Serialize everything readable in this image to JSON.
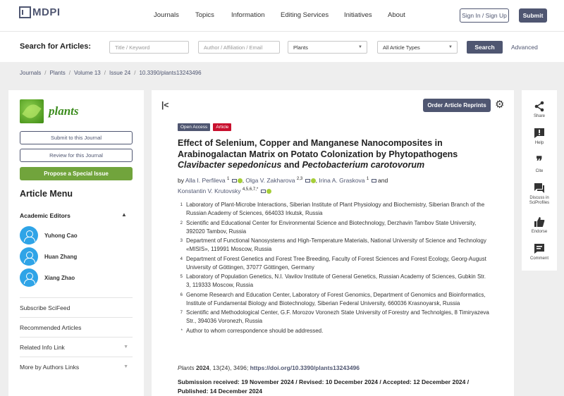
{
  "header": {
    "logo": "MDPI",
    "nav": [
      "Journals",
      "Topics",
      "Information",
      "Editing Services",
      "Initiatives",
      "About"
    ],
    "sign_in": "Sign In / Sign Up",
    "submit": "Submit"
  },
  "search": {
    "label": "Search for Articles:",
    "title_placeholder": "Title / Keyword",
    "author_placeholder": "Author / Affiliation / Email",
    "journal_value": "Plants",
    "type_value": "All Article Types",
    "button": "Search",
    "advanced": "Advanced"
  },
  "breadcrumb": [
    "Journals",
    "Plants",
    "Volume 13",
    "Issue 24",
    "10.3390/plants13243496"
  ],
  "sidebar": {
    "journal_name": "plants",
    "submit_btn": "Submit to this Journal",
    "review_btn": "Review for this Journal",
    "propose_btn": "Propose a Special Issue",
    "menu_title": "Article Menu",
    "academic_editors": "Academic Editors",
    "editors": [
      "Yuhong Cao",
      "Huan Zhang",
      "Xiang Zhao"
    ],
    "links": [
      "Subscribe SciFeed",
      "Recommended Articles",
      "Related Info Link",
      "More by Authors Links"
    ]
  },
  "article": {
    "reprint_btn": "Order Article Reprints",
    "badge_open_access": "Open Access",
    "badge_article": "Article",
    "title_line1": "Effect of Selenium, Copper and Manganese Nanocomposites in",
    "title_line2": "Arabinogalactan Matrix on Potato Colonization by Phytopathogens",
    "title_italic1": "Clavibacter sepedonicus",
    "title_and": " and ",
    "title_italic2": "Pectobacterium carotovorum",
    "by": "by",
    "authors": [
      {
        "name": "Alla I. Perfileva",
        "sup": "1"
      },
      {
        "name": "Olga V. Zakharova",
        "sup": "2,3"
      },
      {
        "name": "Irina A. Graskova",
        "sup": "1"
      },
      {
        "name": "Konstantin V. Krutovsky",
        "sup": "4,5,6,7,*"
      }
    ],
    "and": "and",
    "affiliations": [
      {
        "num": "1",
        "text": "Laboratory of Plant-Microbe Interactions, Siberian Institute of Plant Physiology and Biochemistry, Siberian Branch of the Russian Academy of Sciences, 664033 Irkutsk, Russia"
      },
      {
        "num": "2",
        "text": "Scientific and Educational Center for Environmental Science and Biotechnology, Derzhavin Tambov State University, 392020 Tambov, Russia"
      },
      {
        "num": "3",
        "text": "Department of Functional Nanosystems and High-Temperature Materials, National University of Science and Technology «MISIS», 119991 Moscow, Russia"
      },
      {
        "num": "4",
        "text": "Department of Forest Genetics and Forest Tree Breeding, Faculty of Forest Sciences and Forest Ecology, Georg-August University of Göttingen, 37077 Göttingen, Germany"
      },
      {
        "num": "5",
        "text": "Laboratory of Population Genetics, N.I. Vavilov Institute of General Genetics, Russian Academy of Sciences, Gubkin Str. 3, 119333 Moscow, Russia"
      },
      {
        "num": "6",
        "text": "Genome Research and Education Center, Laboratory of Forest Genomics, Department of Genomics and Bioinformatics, Institute of Fundamental Biology and Biotechnology, Siberian Federal University, 660036 Krasnoyarsk, Russia"
      },
      {
        "num": "7",
        "text": "Scientific and Methodological Center, G.F. Morozov Voronezh State University of Forestry and Technolgies, 8 Timiryazeva Str., 394036 Voronezh, Russia"
      },
      {
        "num": "*",
        "text": "Author to whom correspondence should be addressed."
      }
    ],
    "citation_journal": "Plants",
    "citation_year": "2024",
    "citation_rest": ", 13(24), 3496; ",
    "doi": "https://doi.org/10.3390/plants13243496",
    "dates": "Submission received: 19 November 2024 / Revised: 10 December 2024 / Accepted: 12 December 2024 / Published: 14 December 2024"
  },
  "actions": [
    {
      "icon": "share-icon",
      "label": "Share"
    },
    {
      "icon": "help-icon",
      "label": "Help"
    },
    {
      "icon": "cite-icon",
      "label": "Cite"
    },
    {
      "icon": "discuss-icon",
      "label": "Discuss in SciProfiles"
    },
    {
      "icon": "endorse-icon",
      "label": "Endorse"
    },
    {
      "icon": "comment-icon",
      "label": "Comment"
    }
  ],
  "colors": {
    "brand": "#4f5671",
    "green": "#71a43c",
    "red": "#c8102e",
    "avatar": "#2fa4e7"
  }
}
